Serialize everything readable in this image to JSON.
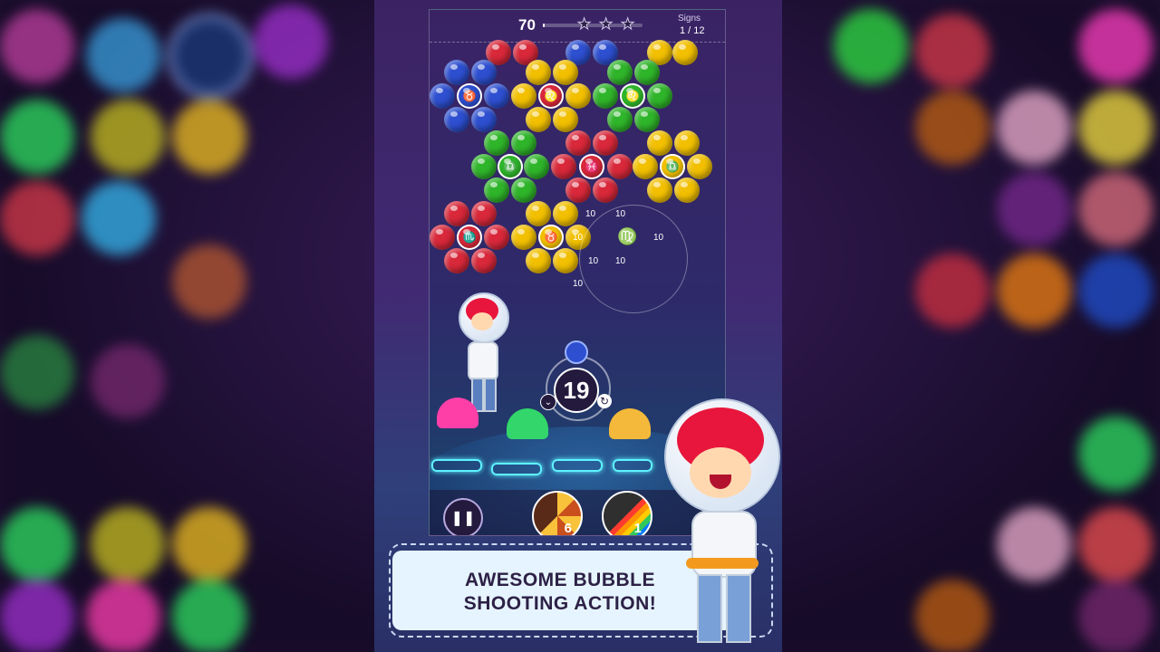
{
  "hud": {
    "score": "70",
    "signs_label": "Signs",
    "signs_value": "1 / 12",
    "star_progress": 0.02,
    "stars_earned": 0,
    "stars_total": 3
  },
  "bubble_labels": {
    "capricorn": "♑",
    "leo": "♌",
    "taurus_like": "♉",
    "pisces": "♓",
    "libra": "♎",
    "scorpio_like": "♏",
    "virgo": "♍"
  },
  "burst_points": [
    "10",
    "10",
    "10",
    "10",
    "10",
    "10",
    "10"
  ],
  "shooter": {
    "shots_left": "19",
    "next_bubble_color": "blue",
    "swap_glyph": "↻",
    "aim_glyph": "⌄"
  },
  "controls": {
    "pause_glyph": "❚❚",
    "powerups": [
      {
        "name": "sunburst",
        "count": "6"
      },
      {
        "name": "rainbow",
        "count": "1"
      }
    ]
  },
  "caption": {
    "line1": "AWESOME BUBBLE",
    "line2": "SHOOTING ACTION!"
  },
  "colors": {
    "red": "#d8283a",
    "yellow": "#f2c000",
    "blue": "#2d4fd0",
    "green": "#2fb52a",
    "neon": "#5ef2ff"
  }
}
